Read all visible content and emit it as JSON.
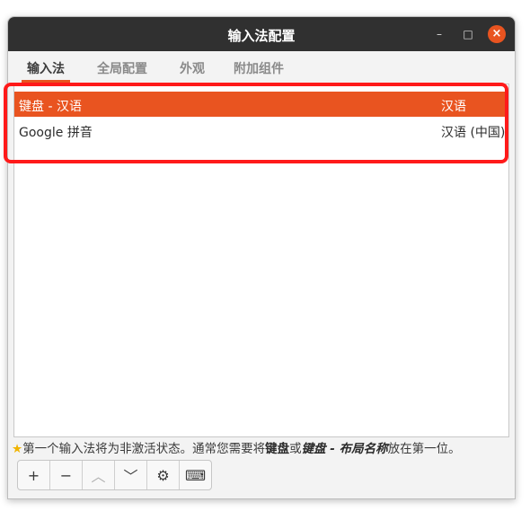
{
  "window": {
    "title": "输入法配置",
    "controls": {
      "minimize": "–",
      "maximize": "□",
      "close": "×"
    }
  },
  "tabs": [
    {
      "label": "输入法",
      "active": true
    },
    {
      "label": "全局配置",
      "active": false
    },
    {
      "label": "外观",
      "active": false
    },
    {
      "label": "附加组件",
      "active": false
    }
  ],
  "input_methods": [
    {
      "name": "键盘 - 汉语",
      "language": "汉语",
      "selected": true
    },
    {
      "name": "Google 拼音",
      "language": "汉语 (中国)",
      "selected": false
    }
  ],
  "hint": {
    "icon": "star-icon",
    "text_1": "第一个输入法将为非激活状态。通常您需要将",
    "bold_1": "键盘",
    "text_2": "或",
    "bold_2": "键盘 - 布局名称",
    "text_3": "放在第一位。"
  },
  "toolbar": {
    "add": "+",
    "remove": "−",
    "up": "︿",
    "down": "﹀",
    "configure": "⚙",
    "keyboard": "⌨"
  },
  "colors": {
    "accent": "#e95420",
    "titlebar": "#303030",
    "highlight_box": "#ff1a1a"
  }
}
